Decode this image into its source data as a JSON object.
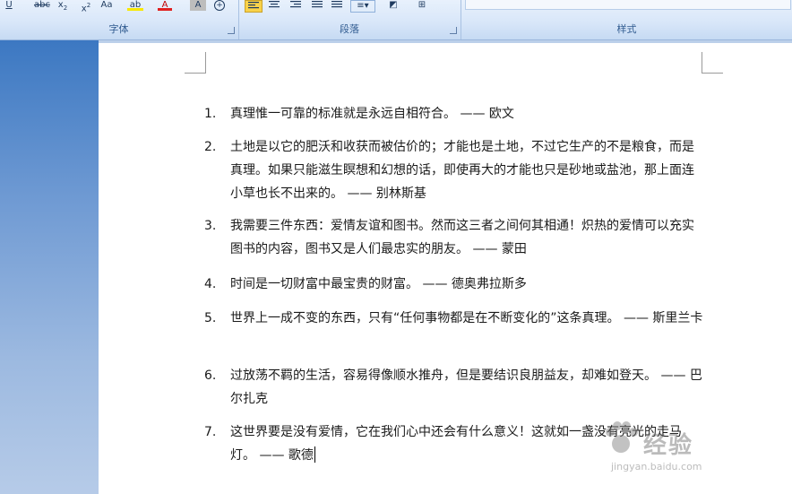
{
  "ribbon": {
    "font_group_label": "字体",
    "paragraph_group_label": "段落",
    "styles_group_label": "样式"
  },
  "document": {
    "items": [
      {
        "num": "1.",
        "text": "真理惟一可靠的标准就是永远自相符合。 —— 欧文"
      },
      {
        "num": "2.",
        "text": "土地是以它的肥沃和收获而被估价的；才能也是土地，不过它生产的不是粮食，而是真理。如果只能滋生瞑想和幻想的话，即使再大的才能也只是砂地或盐池，那上面连小草也长不出来的。 —— 别林斯基"
      },
      {
        "num": "3.",
        "text": "我需要三件东西：爱情友谊和图书。然而这三者之间何其相通！炽热的爱情可以充实图书的内容，图书又是人们最忠实的朋友。 —— 蒙田"
      },
      {
        "num": "4.",
        "text": "时间是一切财富中最宝贵的财富。 —— 德奥弗拉斯多"
      },
      {
        "num": "5.",
        "text": "世界上一成不变的东西，只有“任何事物都是在不断变化的”这条真理。 —— 斯里兰卡"
      },
      {
        "num": "6.",
        "text": "过放荡不羁的生活，容易得像顺水推舟，但是要结识良朋益友，却难如登天。 —— 巴尔扎克"
      },
      {
        "num": "7.",
        "text": "这世界要是没有爱情，它在我们心中还会有什么意义！这就如一盏没有亮光的走马灯。 —— 歌德"
      }
    ]
  },
  "watermark": {
    "brand": "经验",
    "url": "jingyan.baidu.com"
  },
  "colors": {
    "ribbon_bg": "#d9e7f9",
    "accent_blue": "#3c78c2",
    "highlight_yellow": "#f8d24a",
    "font_color_red": "#e02020"
  }
}
